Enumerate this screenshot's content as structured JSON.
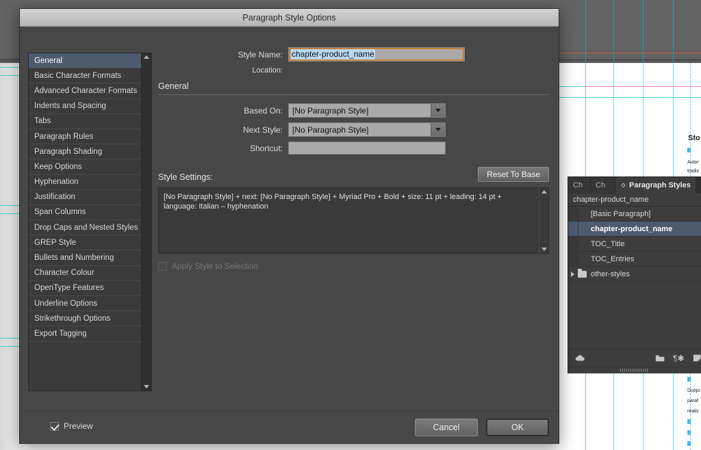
{
  "dialog": {
    "title": "Paragraph Style Options",
    "style_name_label": "Style Name:",
    "style_name_value": "chapter-product_name",
    "location_label": "Location:",
    "location_value": "",
    "section_title": "General",
    "based_on_label": "Based On:",
    "based_on_value": "[No Paragraph Style]",
    "next_style_label": "Next Style:",
    "next_style_value": "[No Paragraph Style]",
    "shortcut_label": "Shortcut:",
    "shortcut_value": "",
    "style_settings_label": "Style Settings:",
    "reset_to_base_label": "Reset To Base",
    "style_settings_text": "[No Paragraph Style] + next: [No Paragraph Style] + Myriad Pro + Bold + size: 11 pt + leading: 14 pt + language: Italian – hyphenation",
    "apply_style_label": "Apply Style to Selection",
    "preview_label": "Preview",
    "cancel_label": "Cancel",
    "ok_label": "OK",
    "focus_color": "#c8803a",
    "selection_color": "#b8d8f5"
  },
  "sidebar": {
    "items": [
      {
        "label": "General",
        "active": true
      },
      {
        "label": "Basic Character Formats",
        "active": false
      },
      {
        "label": "Advanced Character Formats",
        "active": false
      },
      {
        "label": "Indents and Spacing",
        "active": false
      },
      {
        "label": "Tabs",
        "active": false
      },
      {
        "label": "Paragraph Rules",
        "active": false
      },
      {
        "label": "Paragraph Shading",
        "active": false
      },
      {
        "label": "Keep Options",
        "active": false
      },
      {
        "label": "Hyphenation",
        "active": false
      },
      {
        "label": "Justification",
        "active": false
      },
      {
        "label": "Span Columns",
        "active": false
      },
      {
        "label": "Drop Caps and Nested Styles",
        "active": false
      },
      {
        "label": "GREP Style",
        "active": false
      },
      {
        "label": "Bullets and Numbering",
        "active": false
      },
      {
        "label": "Character Colour",
        "active": false
      },
      {
        "label": "OpenType Features",
        "active": false
      },
      {
        "label": "Underline Options",
        "active": false
      },
      {
        "label": "Strikethrough Options",
        "active": false
      },
      {
        "label": "Export Tagging",
        "active": false
      }
    ]
  },
  "styles_panel": {
    "tabs": [
      {
        "label": "Ch",
        "active": false
      },
      {
        "label": "Ch",
        "active": false
      },
      {
        "label": "Paragraph Styles",
        "active": true
      }
    ],
    "current_style": "chapter-product_name",
    "rows": [
      {
        "label": "[Basic Paragraph]",
        "selected": false,
        "type": "style"
      },
      {
        "label": "chapter-product_name",
        "selected": true,
        "type": "style"
      },
      {
        "label": "TOC_Title",
        "selected": false,
        "type": "style"
      },
      {
        "label": "TOC_Entries",
        "selected": false,
        "type": "style"
      },
      {
        "label": "other-styles",
        "selected": false,
        "type": "group"
      }
    ],
    "footer_icons": [
      "cloud-upload-icon",
      "new-group-icon",
      "clear-overrides-icon",
      "new-style-icon"
    ],
    "selected_color": "#4e5a6e"
  },
  "document": {
    "fragments": [
      {
        "text": "Sto",
        "kind": "heading"
      },
      {
        "text": "Autor",
        "kind": "body"
      },
      {
        "text": "tradiz",
        "kind": "body"
      },
      {
        "text": "Duepi",
        "kind": "body"
      },
      {
        "text": "paraf",
        "kind": "body"
      },
      {
        "text": "realiz",
        "kind": "body"
      }
    ],
    "guide_colors": {
      "column": "#5fe4ec",
      "margin": "#d98fe0",
      "baseline": "#b9c9e8",
      "ruler": "#c8613c"
    }
  }
}
